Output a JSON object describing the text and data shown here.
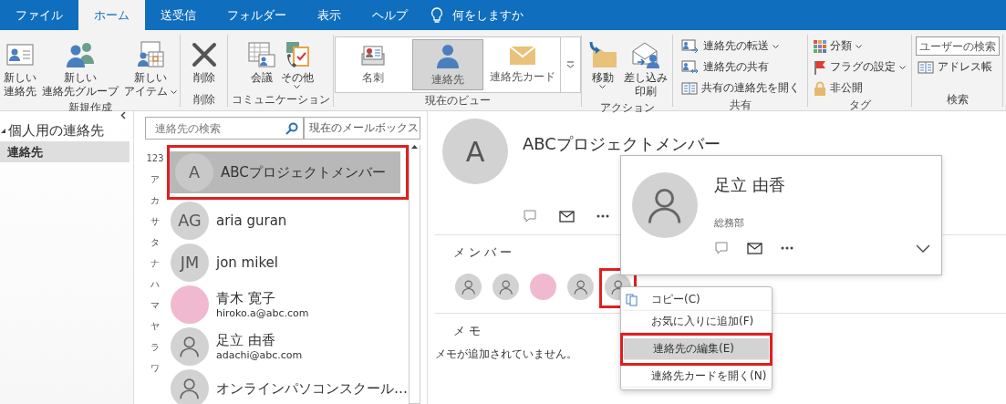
{
  "tabs": [
    {
      "label": "ファイル",
      "selected": false
    },
    {
      "label": "ホーム",
      "selected": true
    },
    {
      "label": "送受信",
      "selected": false
    },
    {
      "label": "フォルダー",
      "selected": false
    },
    {
      "label": "表示",
      "selected": false
    },
    {
      "label": "ヘルプ",
      "selected": false
    }
  ],
  "tell_me": "何をしますか",
  "ribbon": [
    {
      "label": "新規作成",
      "kind": "large",
      "items": [
        {
          "lines": [
            "新しい",
            "連絡先"
          ],
          "dropdown": false
        },
        {
          "lines": [
            "新しい",
            "連絡先グループ"
          ],
          "dropdown": false
        },
        {
          "lines": [
            "新しい",
            "アイテム"
          ],
          "dropdown": true
        }
      ]
    },
    {
      "label": "削除",
      "kind": "large",
      "items": [
        {
          "lines": [
            "削除"
          ],
          "dropdown": false
        }
      ]
    },
    {
      "label": "コミュニケーション",
      "kind": "large",
      "items": [
        {
          "lines": [
            "会議"
          ],
          "dropdown": false
        },
        {
          "lines": [
            "その他"
          ],
          "dropdown": true
        }
      ]
    },
    {
      "label": "現在のビュー",
      "kind": "gallery",
      "items": [
        {
          "label": "名刺",
          "selected": false
        },
        {
          "label": "連絡先",
          "selected": true
        },
        {
          "label": "連絡先カード",
          "selected": false
        }
      ]
    },
    {
      "label": "アクション",
      "kind": "large",
      "items": [
        {
          "lines": [
            "移動"
          ],
          "dropdown": true
        },
        {
          "lines": [
            "差し込み",
            "印刷"
          ],
          "dropdown": false
        }
      ]
    },
    {
      "label": "共有",
      "kind": "small",
      "items": [
        {
          "label": "連絡先の転送",
          "dropdown": true
        },
        {
          "label": "連絡先の共有",
          "dropdown": false
        },
        {
          "label": "共有の連絡先を開く",
          "dropdown": false
        }
      ]
    },
    {
      "label": "タグ",
      "kind": "small",
      "items": [
        {
          "label": "分類",
          "dropdown": true
        },
        {
          "label": "フラグの設定",
          "dropdown": true
        },
        {
          "label": "非公開",
          "dropdown": false
        }
      ]
    },
    {
      "label": "検索",
      "kind": "search",
      "field": {
        "placeholder": "ユーザーの検索"
      },
      "items": [
        {
          "label": "アドレス帳",
          "dropdown": false
        }
      ]
    }
  ],
  "nav": {
    "header": "個人用の連絡先",
    "items": [
      {
        "label": "連絡先",
        "selected": true
      }
    ]
  },
  "contact_list": {
    "search": {
      "placeholder": "連絡先の検索"
    },
    "scope": "現在のメールボックス",
    "index": [
      "123",
      "ア",
      "カ",
      "サ",
      "タ",
      "ナ",
      "ハ",
      "マ",
      "ヤ",
      "ラ",
      "ワ"
    ],
    "contacts": [
      {
        "kind": "initials",
        "initials": "A",
        "name": "ABCプロジェクトメンバー",
        "selected": true,
        "highlighted": true
      },
      {
        "kind": "initials",
        "initials": "AG",
        "name": "aria guran",
        "selected": false,
        "highlighted": false
      },
      {
        "kind": "initials",
        "initials": "JM",
        "name": "jon mikel",
        "selected": false,
        "highlighted": false
      },
      {
        "kind": "photo",
        "name": "青木 寛子",
        "email": "hiroko.a@abc.com",
        "selected": false,
        "highlighted": false
      },
      {
        "kind": "silhouette",
        "name": "足立 由香",
        "email": "adachi@abc.com",
        "selected": false,
        "highlighted": false
      },
      {
        "kind": "silhouette",
        "name": "オンラインパソコンスクール…",
        "selected": false,
        "highlighted": false
      }
    ]
  },
  "detail": {
    "initials": "A",
    "title": "ABCプロジェクトメンバー",
    "members_label": "メンバー",
    "members": [
      {
        "kind": "silhouette",
        "highlighted": false
      },
      {
        "kind": "silhouette",
        "highlighted": false
      },
      {
        "kind": "photo",
        "highlighted": false
      },
      {
        "kind": "silhouette",
        "highlighted": false
      },
      {
        "kind": "silhouette",
        "highlighted": true
      }
    ],
    "memo_label": "メモ",
    "memo": "メモが追加されていません。"
  },
  "contact_card": {
    "name": "足立 由香",
    "department": "総務部"
  },
  "context_menu": [
    {
      "label": "コピー(C)",
      "selected": false,
      "highlighted": false
    },
    {
      "label": "お気に入りに追加(F)",
      "selected": false,
      "highlighted": false
    },
    {
      "label": "連絡先の編集(E)",
      "selected": true,
      "highlighted": true
    },
    {
      "label": "連絡先カードを開く(N)",
      "selected": false,
      "highlighted": false
    }
  ]
}
